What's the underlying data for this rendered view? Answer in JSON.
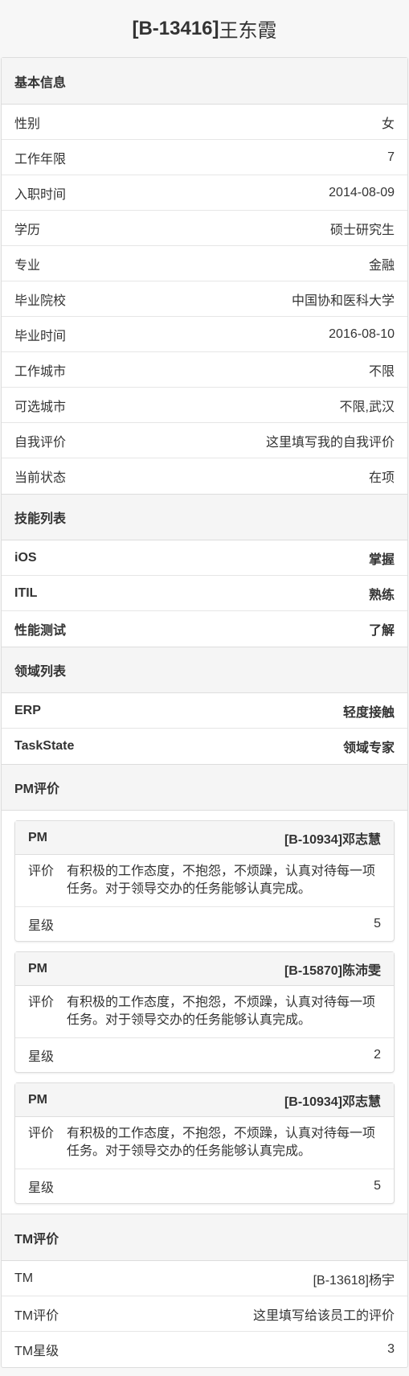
{
  "header": {
    "code": "[B-13416]",
    "name": "王东霞"
  },
  "basic_info": {
    "title": "基本信息",
    "rows": [
      {
        "label": "性别",
        "value": "女"
      },
      {
        "label": "工作年限",
        "value": "7"
      },
      {
        "label": "入职时间",
        "value": "2014-08-09"
      },
      {
        "label": "学历",
        "value": "硕士研究生"
      },
      {
        "label": "专业",
        "value": "金融"
      },
      {
        "label": "毕业院校",
        "value": "中国协和医科大学"
      },
      {
        "label": "毕业时间",
        "value": "2016-08-10"
      },
      {
        "label": "工作城市",
        "value": "不限"
      },
      {
        "label": "可选城市",
        "value": "不限,武汉"
      },
      {
        "label": "自我评价",
        "value": "这里填写我的自我评价"
      },
      {
        "label": "当前状态",
        "value": "在项"
      }
    ]
  },
  "skills": {
    "title": "技能列表",
    "rows": [
      {
        "label": "iOS",
        "value": "掌握"
      },
      {
        "label": "ITIL",
        "value": "熟练"
      },
      {
        "label": "性能测试",
        "value": "了解"
      }
    ]
  },
  "domains": {
    "title": "领域列表",
    "rows": [
      {
        "label": "ERP",
        "value": "轻度接触"
      },
      {
        "label": "TaskState",
        "value": "领域专家"
      }
    ]
  },
  "pm_eval": {
    "title": "PM评价",
    "cards": [
      {
        "role": "PM",
        "person": "[B-10934]邓志慧",
        "eval_label": "评价",
        "eval_text": "有积极的工作态度，不抱怨，不烦躁，认真对待每一项任务。对于领导交办的任务能够认真完成。",
        "star_label": "星级",
        "stars": "5"
      },
      {
        "role": "PM",
        "person": "[B-15870]陈沛雯",
        "eval_label": "评价",
        "eval_text": "有积极的工作态度，不抱怨，不烦躁，认真对待每一项任务。对于领导交办的任务能够认真完成。",
        "star_label": "星级",
        "stars": "2"
      },
      {
        "role": "PM",
        "person": "[B-10934]邓志慧",
        "eval_label": "评价",
        "eval_text": "有积极的工作态度，不抱怨，不烦躁，认真对待每一项任务。对于领导交办的任务能够认真完成。",
        "star_label": "星级",
        "stars": "5"
      }
    ]
  },
  "tm_eval": {
    "title": "TM评价",
    "rows": [
      {
        "label": "TM",
        "value": "[B-13618]杨宇"
      },
      {
        "label": "TM评价",
        "value": "这里填写给该员工的评价"
      },
      {
        "label": "TM星级",
        "value": "3"
      }
    ]
  }
}
